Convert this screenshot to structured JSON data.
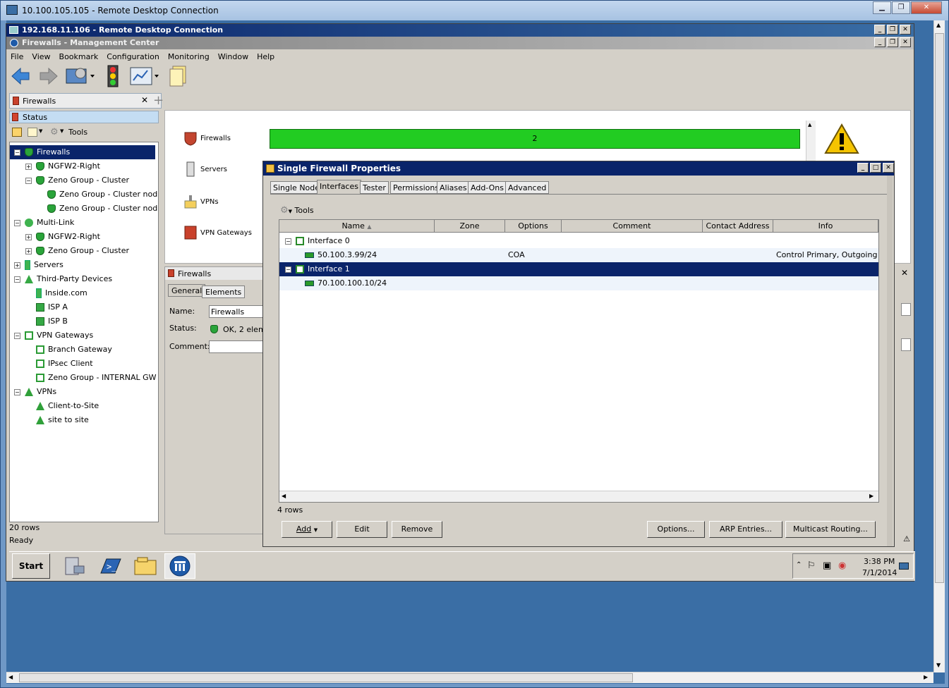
{
  "outer": {
    "title": "10.100.105.105 - Remote Desktop Connection"
  },
  "rdp": {
    "title": "192.168.11.106 - Remote Desktop Connection"
  },
  "app": {
    "title": "Firewalls - Management Center"
  },
  "menu": [
    "File",
    "View",
    "Bookmark",
    "Configuration",
    "Monitoring",
    "Window",
    "Help"
  ],
  "left": {
    "tab_label": "Firewalls",
    "status_label": "Status",
    "tools_label": "Tools",
    "tree": [
      {
        "label": "Firewalls",
        "depth": 0,
        "exp": "−",
        "icon": "fw",
        "selected": true
      },
      {
        "label": "NGFW2-Right",
        "depth": 1,
        "exp": "+",
        "icon": "fw"
      },
      {
        "label": "Zeno Group - Cluster",
        "depth": 1,
        "exp": "−",
        "icon": "fw"
      },
      {
        "label": "Zeno Group - Cluster nod…",
        "depth": 2,
        "exp": "",
        "icon": "fw"
      },
      {
        "label": "Zeno Group - Cluster nod…",
        "depth": 2,
        "exp": "",
        "icon": "fw"
      },
      {
        "label": "Multi-Link",
        "depth": 0,
        "exp": "−",
        "icon": "ml"
      },
      {
        "label": "NGFW2-Right",
        "depth": 1,
        "exp": "+",
        "icon": "fw"
      },
      {
        "label": "Zeno Group - Cluster",
        "depth": 1,
        "exp": "+",
        "icon": "fw"
      },
      {
        "label": "Servers",
        "depth": 0,
        "exp": "+",
        "icon": "srv"
      },
      {
        "label": "Third-Party Devices",
        "depth": 0,
        "exp": "−",
        "icon": "tpd"
      },
      {
        "label": "Inside.com",
        "depth": 1,
        "exp": "",
        "icon": "srv"
      },
      {
        "label": "ISP A",
        "depth": 1,
        "exp": "",
        "icon": "isp"
      },
      {
        "label": "ISP B",
        "depth": 1,
        "exp": "",
        "icon": "isp"
      },
      {
        "label": "VPN Gateways",
        "depth": 0,
        "exp": "−",
        "icon": "vg"
      },
      {
        "label": "Branch Gateway",
        "depth": 1,
        "exp": "",
        "icon": "vg"
      },
      {
        "label": "IPsec Client",
        "depth": 1,
        "exp": "",
        "icon": "vg"
      },
      {
        "label": "Zeno Group -  INTERNAL GW",
        "depth": 1,
        "exp": "",
        "icon": "vg"
      },
      {
        "label": "VPNs",
        "depth": 0,
        "exp": "−",
        "icon": "vpn"
      },
      {
        "label": "Client-to-Site",
        "depth": 1,
        "exp": "",
        "icon": "vpn"
      },
      {
        "label": "site to site",
        "depth": 1,
        "exp": "",
        "icon": "vpn"
      }
    ],
    "rows_count": "20 rows",
    "ready": "Ready"
  },
  "status_panel": {
    "firewalls_label": "Firewalls",
    "servers_label": "Servers",
    "vpns_label": "VPNs",
    "vpn_gateways_label": "VPN Gateways",
    "firewalls_count": "2"
  },
  "props": {
    "header": "Firewalls",
    "tab_general": "General",
    "tab_elements": "Elements",
    "name_label": "Name:",
    "name_value": "Firewalls",
    "status_label": "Status:",
    "status_value": "OK, 2 eleme",
    "comment_label": "Comment:"
  },
  "taskbar": {
    "start_label": "Start",
    "time": "3:38 PM",
    "date": "7/1/2014"
  },
  "dialog": {
    "title": "Single Firewall Properties",
    "tabs": [
      "Single Node",
      "Interfaces",
      "Tester",
      "Permissions",
      "Aliases",
      "Add-Ons",
      "Advanced"
    ],
    "active_tab": 1,
    "tools_label": "Tools",
    "columns": [
      "Name",
      "Zone",
      "Options",
      "Comment",
      "Contact Address",
      "Info"
    ],
    "sort_indicator": "▲",
    "rows": [
      {
        "name": "Interface 0",
        "type": "interface",
        "exp": "−",
        "zone": "",
        "options": "",
        "comment": "",
        "contact": "",
        "info": ""
      },
      {
        "name": "50.100.3.99/24",
        "type": "ip",
        "exp": "",
        "zone": "",
        "options": "COA",
        "comment": "",
        "contact": "",
        "info": "Control Primary, Outgoing"
      },
      {
        "name": "Interface 1",
        "type": "interface",
        "exp": "−",
        "zone": "",
        "options": "",
        "comment": "",
        "contact": "",
        "info": "",
        "selected": true
      },
      {
        "name": "70.100.100.10/24",
        "type": "ip",
        "exp": "",
        "zone": "",
        "options": "",
        "comment": "",
        "contact": "",
        "info": ""
      }
    ],
    "rows_count": "4 rows",
    "buttons": {
      "add": "Add",
      "edit": "Edit",
      "remove": "Remove",
      "options": "Options...",
      "arp": "ARP Entries...",
      "multicast": "Multicast Routing..."
    }
  },
  "colors": {
    "accent": "#0a246a",
    "status_ok": "#22cc22",
    "warn": "#f5c400"
  },
  "icons": {
    "back": "back-arrow-icon",
    "forward": "forward-arrow-icon",
    "configuration": "configuration-icon",
    "monitoring": "traffic-light-icon",
    "overview": "chart-icon",
    "documents": "documents-icon",
    "warning": "warning-icon"
  }
}
